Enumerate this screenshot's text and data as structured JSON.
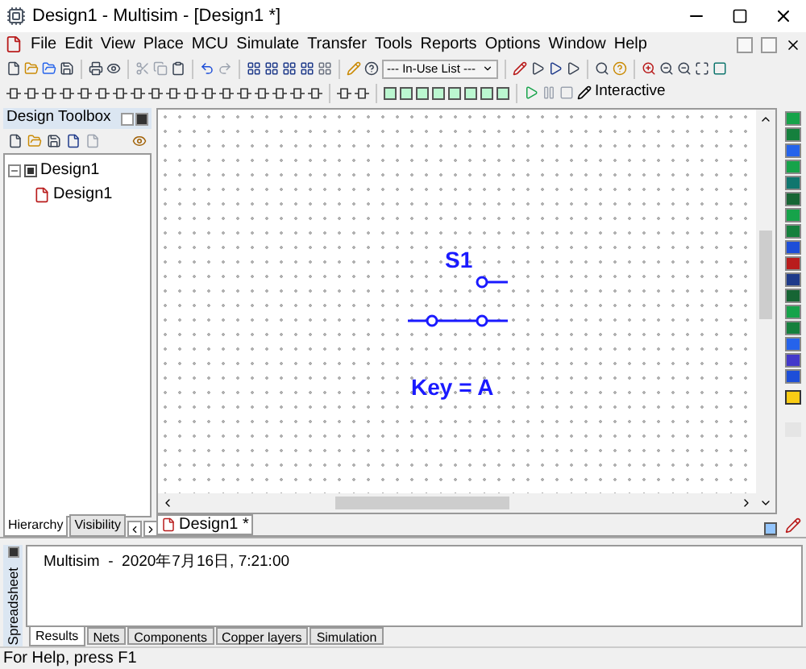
{
  "window": {
    "title": "Design1 - Multisim - [Design1 *]"
  },
  "menu": [
    "File",
    "Edit",
    "View",
    "Place",
    "MCU",
    "Simulate",
    "Transfer",
    "Tools",
    "Reports",
    "Options",
    "Window",
    "Help"
  ],
  "toolbar": {
    "list_dropdown": "--- In-Use List ---",
    "mode": "Interactive"
  },
  "design_toolbox": {
    "title": "Design Toolbox",
    "tree": [
      {
        "label": "Design1",
        "checked": true,
        "expanded": true,
        "children": [
          {
            "label": "Design1"
          }
        ]
      }
    ],
    "tabs": [
      {
        "label": "Hierarchy",
        "selected": true
      },
      {
        "label": "Visibility",
        "selected": false
      }
    ]
  },
  "schematic": {
    "component": {
      "ref": "S1",
      "value": "Key = A"
    },
    "tabs": [
      {
        "label": "Design1 *",
        "selected": true
      }
    ]
  },
  "spreadsheet": {
    "title": "Spreadsheet",
    "messages": [
      "Multisim  -  2020年7月16日, 7:21:00"
    ],
    "tabs": [
      {
        "label": "Results",
        "selected": true
      },
      {
        "label": "Nets",
        "selected": false
      },
      {
        "label": "Components",
        "selected": false
      },
      {
        "label": "Copper layers",
        "selected": false
      },
      {
        "label": "Simulation",
        "selected": false
      }
    ]
  },
  "status_bar": {
    "text": "For Help, press F1"
  }
}
